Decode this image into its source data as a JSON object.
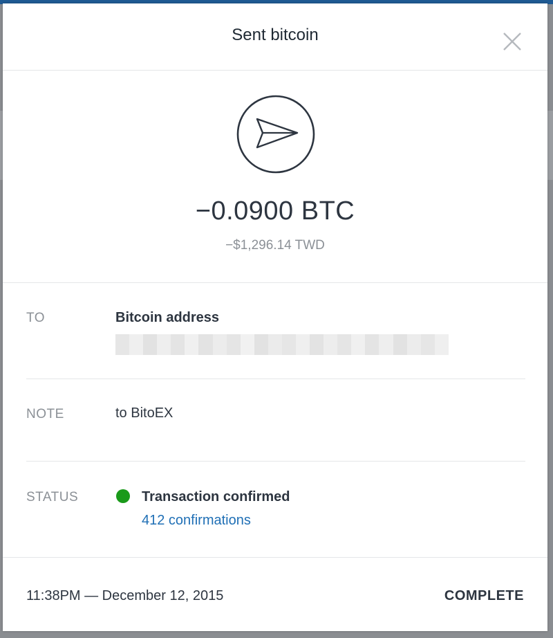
{
  "modal": {
    "title": "Sent bitcoin",
    "close_icon": "close-icon",
    "send_icon": "paper-plane-icon"
  },
  "transaction": {
    "amount": "−0.0900 BTC",
    "fiat": "−$1,296.14 TWD"
  },
  "rows": {
    "to": {
      "label": "TO",
      "value": "Bitcoin address",
      "address": ""
    },
    "note": {
      "label": "NOTE",
      "value": "to BitoEX"
    },
    "status": {
      "label": "STATUS",
      "value": "Transaction confirmed",
      "link": "412 confirmations"
    }
  },
  "footer": {
    "timestamp": "11:38PM — December 12, 2015",
    "state": "COMPLETE"
  },
  "colors": {
    "status_ok": "#1a9a1a",
    "link": "#1f6fb5",
    "text": "#2d3540",
    "muted": "#8b9096"
  }
}
